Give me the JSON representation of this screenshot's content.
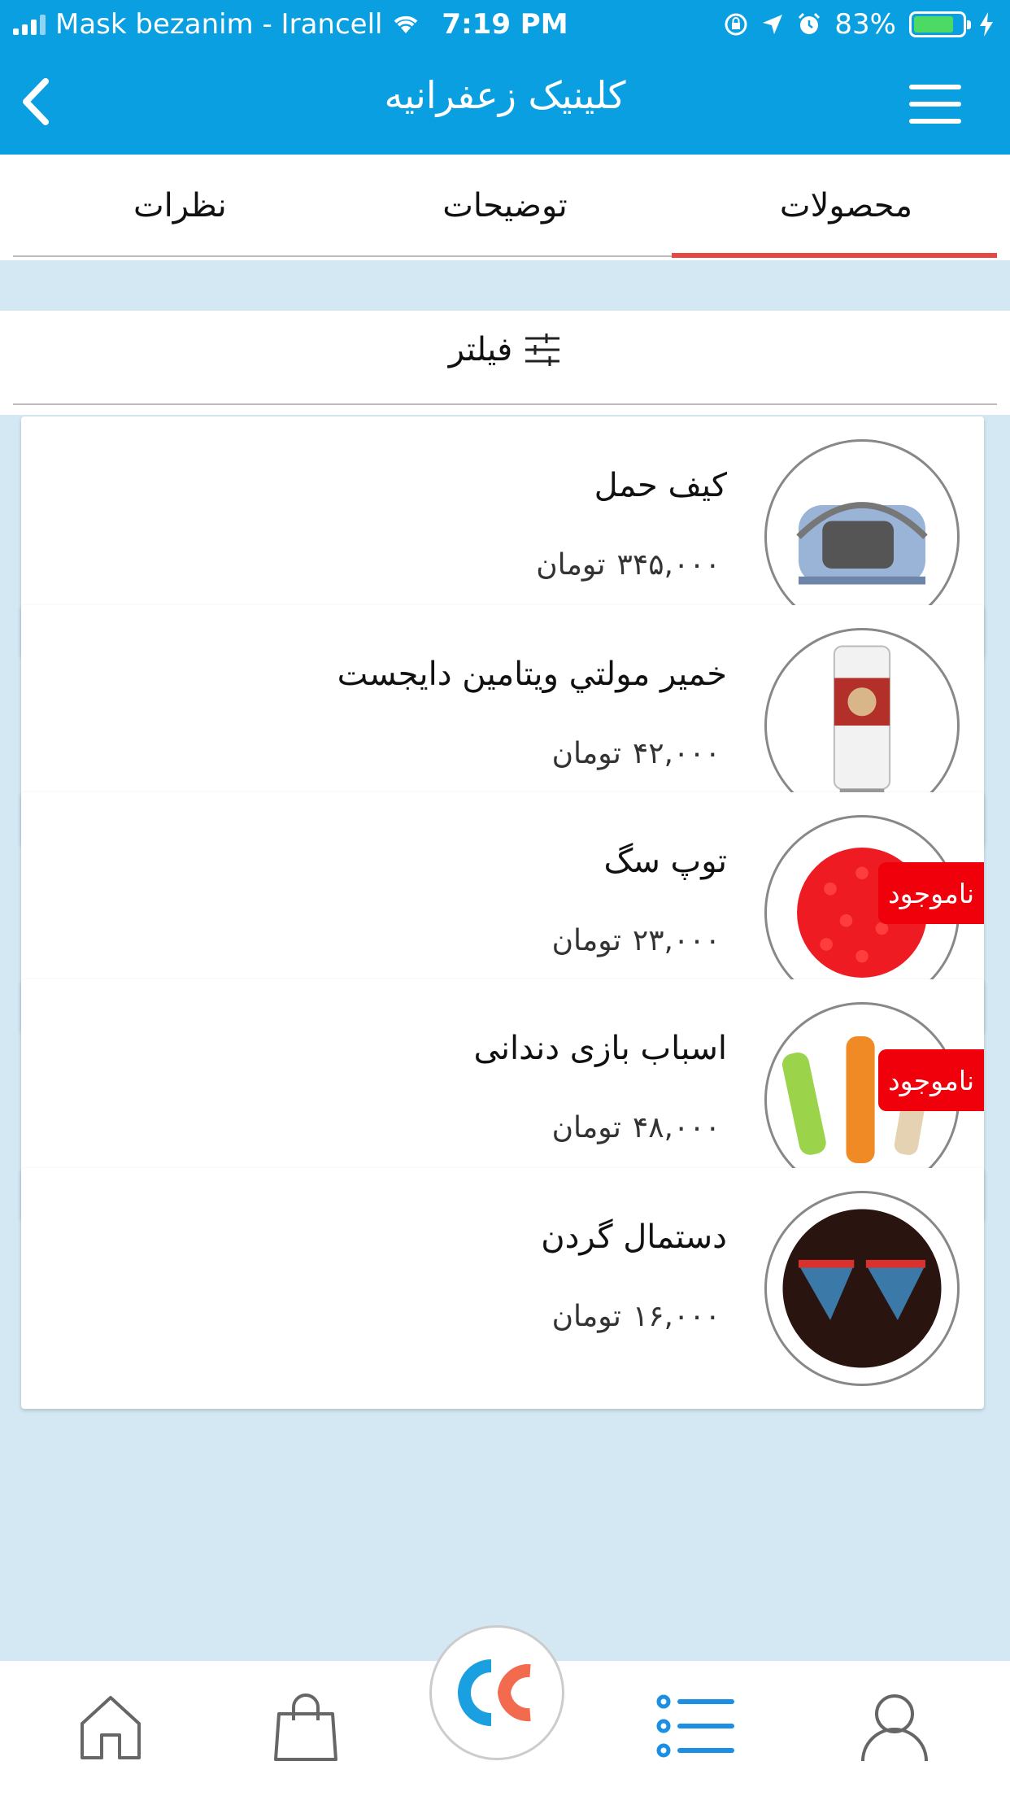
{
  "status_bar": {
    "carrier": "Mask bezanim - Irancell",
    "time": "7:19 PM",
    "battery": "83%",
    "battery_level": 0.83
  },
  "nav": {
    "title": "کلینیک زعفرانیه",
    "back_icon": "chevron-left-icon",
    "menu_icon": "hamburger-menu-icon"
  },
  "tabs": [
    {
      "label": "محصولات",
      "active": true
    },
    {
      "label": "توضیحات",
      "active": false
    },
    {
      "label": "نظرات",
      "active": false
    }
  ],
  "filter": {
    "label": "فیلتر",
    "icon": "sliders-icon"
  },
  "products": [
    {
      "name": "کیف حمل",
      "price": "۳۴۵,۰۰۰",
      "currency": "تومان",
      "out_of_stock": false,
      "image": "pet-carrier-bag"
    },
    {
      "name": "خمیر مولتي ويتامين دايجست",
      "price": "۴۲,۰۰۰",
      "currency": "تومان",
      "out_of_stock": false,
      "image": "vitamin-paste-tube"
    },
    {
      "name": "توپ سگ",
      "price": "۲۳,۰۰۰",
      "currency": "تومان",
      "out_of_stock": true,
      "badge": "ناموجود",
      "image": "red-spiky-ball"
    },
    {
      "name": "اسباب بازی دندانی",
      "price": "۴۸,۰۰۰",
      "currency": "تومان",
      "out_of_stock": true,
      "badge": "ناموجود",
      "image": "dental-chew-toys"
    },
    {
      "name": "دستمال گردن",
      "price": "۱۶,۰۰۰",
      "currency": "تومان",
      "out_of_stock": false,
      "image": "denim-bandanas"
    }
  ],
  "bottom_nav": [
    {
      "name": "home",
      "icon": "home-icon"
    },
    {
      "name": "shop",
      "icon": "shopping-bag-icon"
    },
    {
      "name": "center",
      "icon": "app-logo-icon"
    },
    {
      "name": "list",
      "icon": "list-icon",
      "active": true
    },
    {
      "name": "profile",
      "icon": "user-icon"
    }
  ],
  "colors": {
    "primary": "#0a9fe0",
    "tab_indicator": "#e84545",
    "badge": "#f0000a",
    "background": "#d4e8f3"
  }
}
